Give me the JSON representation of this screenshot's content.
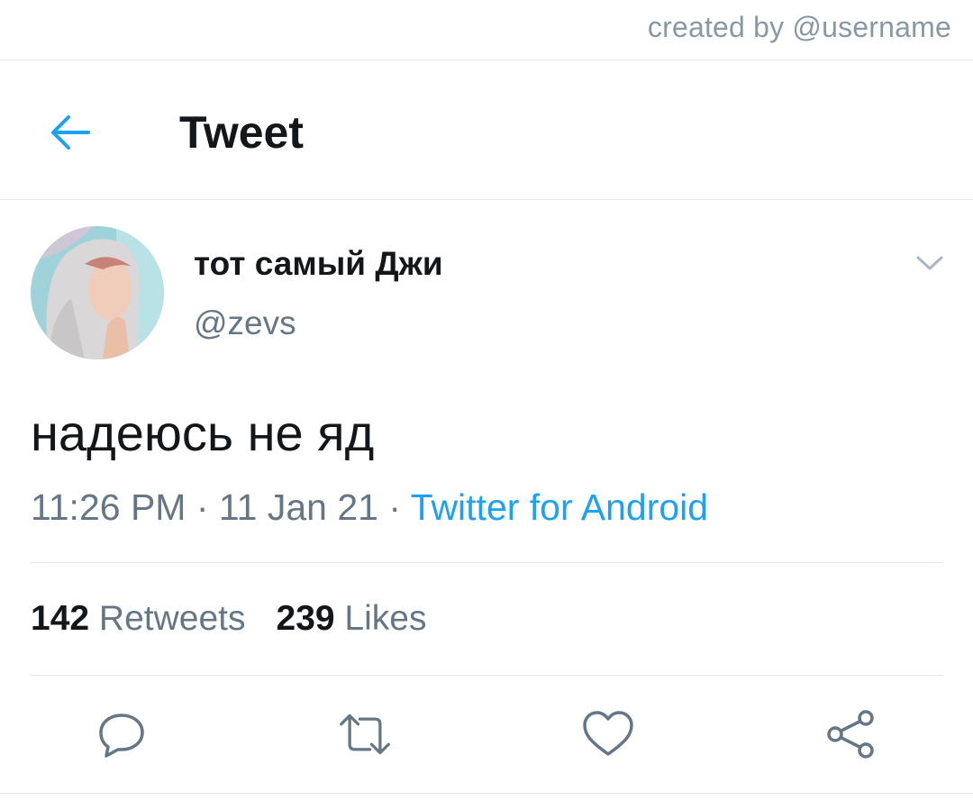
{
  "watermark": "created by @username",
  "header": {
    "title": "Tweet",
    "back_icon": "arrow-left-icon"
  },
  "tweet": {
    "display_name": "тот самый Джи",
    "handle": "@zevs",
    "text": "надеюсь не яд",
    "time": "11:26 PM",
    "date": "11 Jan 21",
    "separator": " · ",
    "source": "Twitter for Android",
    "retweets": "142",
    "retweets_label": "Retweets",
    "likes": "239",
    "likes_label": "Likes"
  },
  "actions": {
    "reply_icon": "reply-icon",
    "retweet_icon": "retweet-icon",
    "like_icon": "heart-icon",
    "share_icon": "share-icon"
  },
  "colors": {
    "accent": "#1da1f2",
    "text": "#14171a",
    "secondary": "#657786",
    "divider": "#e1e8ed"
  }
}
